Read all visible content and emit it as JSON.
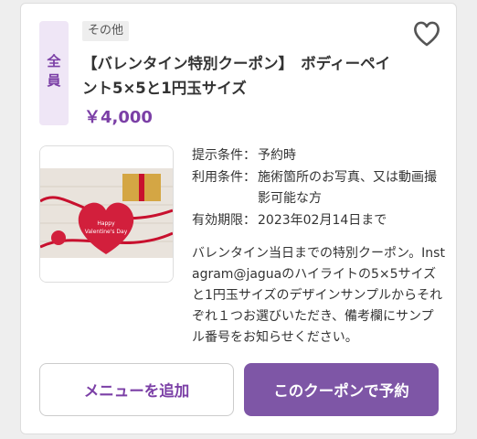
{
  "coupon": {
    "badge": "全員",
    "tag": "その他",
    "title": "【バレンタイン特別クーポン】　ボディーペイント5×5と1円玉サイズ",
    "price": "￥4,000",
    "image_text": "Happy Valentine's Day",
    "conditions": [
      {
        "label": "提示条件：",
        "value": "予約時"
      },
      {
        "label": "利用条件：",
        "value": "施術箇所のお写真、又は動画撮影可能な方"
      },
      {
        "label": "有効期限：",
        "value": "2023年02月14日まで"
      }
    ],
    "description": "バレンタイン当日までの特別クーポン。Instagram@jaguaのハイライトの5×5サイズと1円玉サイズのデザインサンプルからそれぞれ１つお選びいただき、備考欄にサンプル番号をお知らせください。"
  },
  "buttons": {
    "add_menu": "メニューを追加",
    "book": "このクーポンで予約"
  },
  "colors": {
    "accent": "#7b3fa6",
    "button_fill": "#7e56a6",
    "badge_bg": "#efe6f6"
  },
  "icons": {
    "favorite": "heart-outline-icon"
  }
}
